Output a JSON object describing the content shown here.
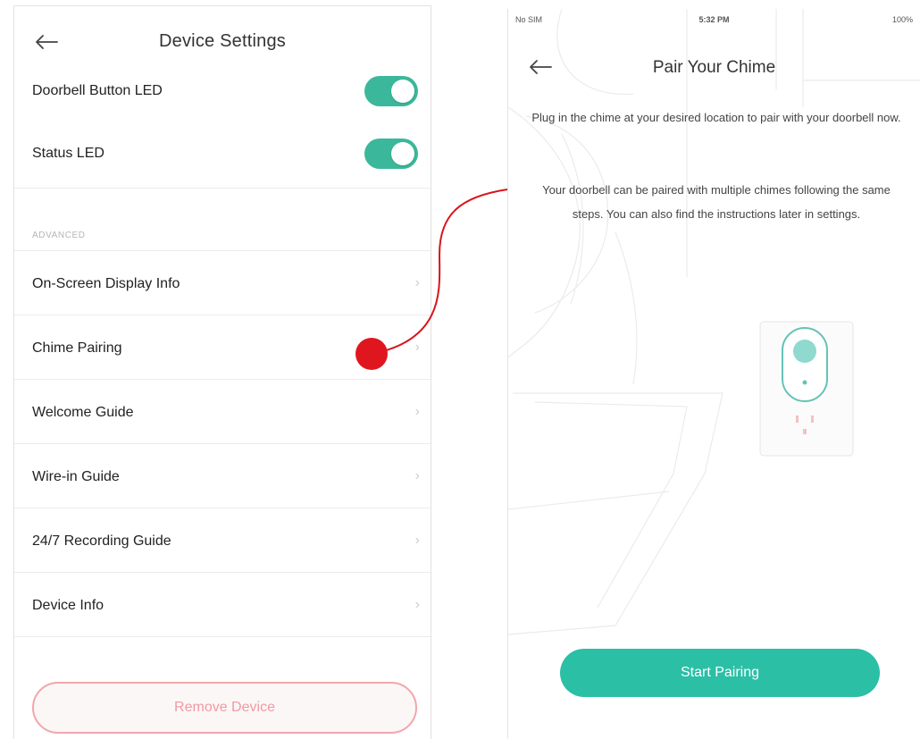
{
  "left": {
    "title": "Device Settings",
    "toggles": [
      {
        "label": "Doorbell Button LED",
        "on": true
      },
      {
        "label": "Status LED",
        "on": true
      }
    ],
    "section_label": "ADVANCED",
    "menu": [
      {
        "label": "On-Screen Display Info"
      },
      {
        "label": "Chime Pairing"
      },
      {
        "label": "Welcome Guide"
      },
      {
        "label": "Wire-in Guide"
      },
      {
        "label": "24/7 Recording Guide"
      },
      {
        "label": "Device Info"
      }
    ],
    "chevron": "›",
    "remove_label": "Remove Device"
  },
  "right": {
    "status": {
      "carrier": "No SIM",
      "time": "5:32 PM",
      "battery": "100%"
    },
    "title": "Pair Your Chime",
    "instruction_1": "Plug in the chime at your desired location to pair with your doorbell now.",
    "instruction_2": "Your doorbell can be paired with multiple chimes following the same steps. You can also find the instructions later in settings.",
    "button_label": "Start Pairing"
  },
  "colors": {
    "accent": "#3bb89b",
    "button": "#2bbfa6",
    "remove_border": "#f2a6ab",
    "remove_text": "#f09aa0",
    "highlight": "#e0161e"
  },
  "icons": {
    "back": "back-arrow-icon",
    "chevron": "chevron-right-icon",
    "wifi": "wifi-icon",
    "chime": "chime-device-icon"
  }
}
